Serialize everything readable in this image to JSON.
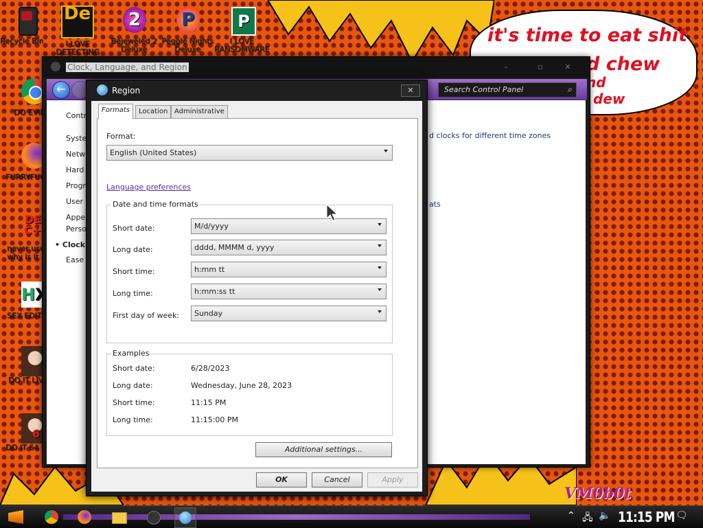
{
  "desktop": {
    "speech_bubble": {
      "line1": "it's time to eat shit",
      "line2": "d chew",
      "line3": "nd",
      "line4": "dew"
    },
    "icons": [
      {
        "label": "Recycle Bin",
        "icon": "recycle-bin-icon"
      },
      {
        "label": "I LOVE DETECTING",
        "icon": "die-icon"
      },
      {
        "label": "Bejeweled 2 Deluxe",
        "icon": "bejeweled-icon"
      },
      {
        "label": "Peggle Nights Deluxe",
        "icon": "peggle-icon"
      },
      {
        "label": "I LOVE RANSOMWARE",
        "icon": "publisher-icon"
      },
      {
        "label": "DO EVIL",
        "icon": "chrome-icon"
      },
      {
        "label": "FURRYFUC",
        "icon": "firefox-icon"
      },
      {
        "label": "never use why is it ...",
        "icon": "devcpp-icon"
      },
      {
        "label": "SEX EDITO",
        "icon": "hxd-icon"
      },
      {
        "label": "DO IT LIV",
        "icon": "portrait-icon"
      },
      {
        "label": "DO IT 64 B",
        "icon": "portrait-64-icon"
      }
    ],
    "watermark": "VM0b0t"
  },
  "control_panel": {
    "title": "Clock, Language, and Region",
    "search_placeholder": "Search Control Panel",
    "left_nav": [
      "Contr",
      "Syste",
      "Netw",
      "Hard",
      "Progr",
      "User",
      "Appe",
      "Perso",
      "Clock",
      "Ease"
    ],
    "right_text_1": "d clocks for different time zones",
    "right_text_2": "ats"
  },
  "dialog": {
    "title": "Region",
    "tabs": [
      "Formats",
      "Location",
      "Administrative"
    ],
    "format_label": "Format:",
    "format_value": "English (United States)",
    "language_link": "Language preferences",
    "dt_group_title": "Date and time formats",
    "fields": [
      {
        "label": "Short date:",
        "value": "M/d/yyyy"
      },
      {
        "label": "Long date:",
        "value": "dddd, MMMM d, yyyy"
      },
      {
        "label": "Short time:",
        "value": "h:mm tt"
      },
      {
        "label": "Long time:",
        "value": "h:mm:ss tt"
      },
      {
        "label": "First day of week:",
        "value": "Sunday"
      }
    ],
    "examples_title": "Examples",
    "examples": [
      {
        "label": "Short date:",
        "value": "6/28/2023"
      },
      {
        "label": "Long date:",
        "value": "Wednesday, June 28, 2023"
      },
      {
        "label": "Short time:",
        "value": "11:15 PM"
      },
      {
        "label": "Long time:",
        "value": "11:15:00 PM"
      }
    ],
    "additional_settings": "Additional settings...",
    "ok": "OK",
    "cancel": "Cancel",
    "apply": "Apply"
  },
  "taskbar": {
    "clock": "11:15 PM"
  },
  "colors": {
    "accent_purple": "#7a3fb8",
    "link": "#5a2d9e",
    "wallpaper": "#e8560f"
  }
}
